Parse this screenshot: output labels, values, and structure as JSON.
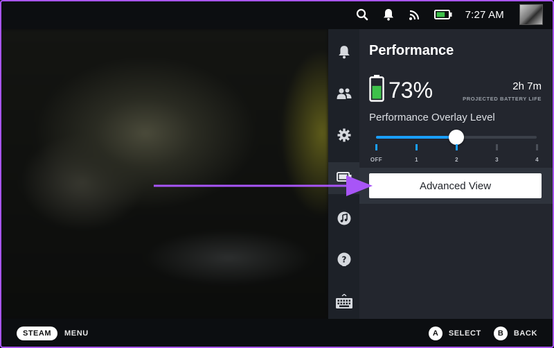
{
  "status_bar": {
    "time": "7:27 AM",
    "icons": [
      "search-icon",
      "notification-bell-icon",
      "wifi-icon",
      "battery-icon"
    ],
    "battery_color": "#3ec14a"
  },
  "rail": {
    "items": [
      {
        "icon": "notifications-icon",
        "active": false
      },
      {
        "icon": "friends-icon",
        "active": false
      },
      {
        "icon": "settings-icon",
        "active": false
      },
      {
        "icon": "performance-battery-icon",
        "active": true
      },
      {
        "icon": "music-icon",
        "active": false
      },
      {
        "icon": "help-icon",
        "active": false
      },
      {
        "icon": "keyboard-icon",
        "active": false
      }
    ]
  },
  "panel": {
    "title": "Performance",
    "battery_percent_text": "73%",
    "battery_fraction": 0.73,
    "time_left": "2h 7m",
    "time_left_caption": "PROJECTED BATTERY LIFE",
    "overlay_label": "Performance Overlay Level",
    "overlay_levels": [
      "OFF",
      "1",
      "2",
      "3",
      "4"
    ],
    "overlay_selected_index": 2,
    "advanced_button": "Advanced View"
  },
  "bottom_bar": {
    "steam_label": "STEAM",
    "menu_label": "MENU",
    "a_button": "A",
    "select_label": "SELECT",
    "b_button": "B",
    "back_label": "BACK"
  },
  "colors": {
    "accent": "#1a9fff",
    "annotation_arrow": "#a855f7",
    "panel_bg": "#23262e"
  }
}
